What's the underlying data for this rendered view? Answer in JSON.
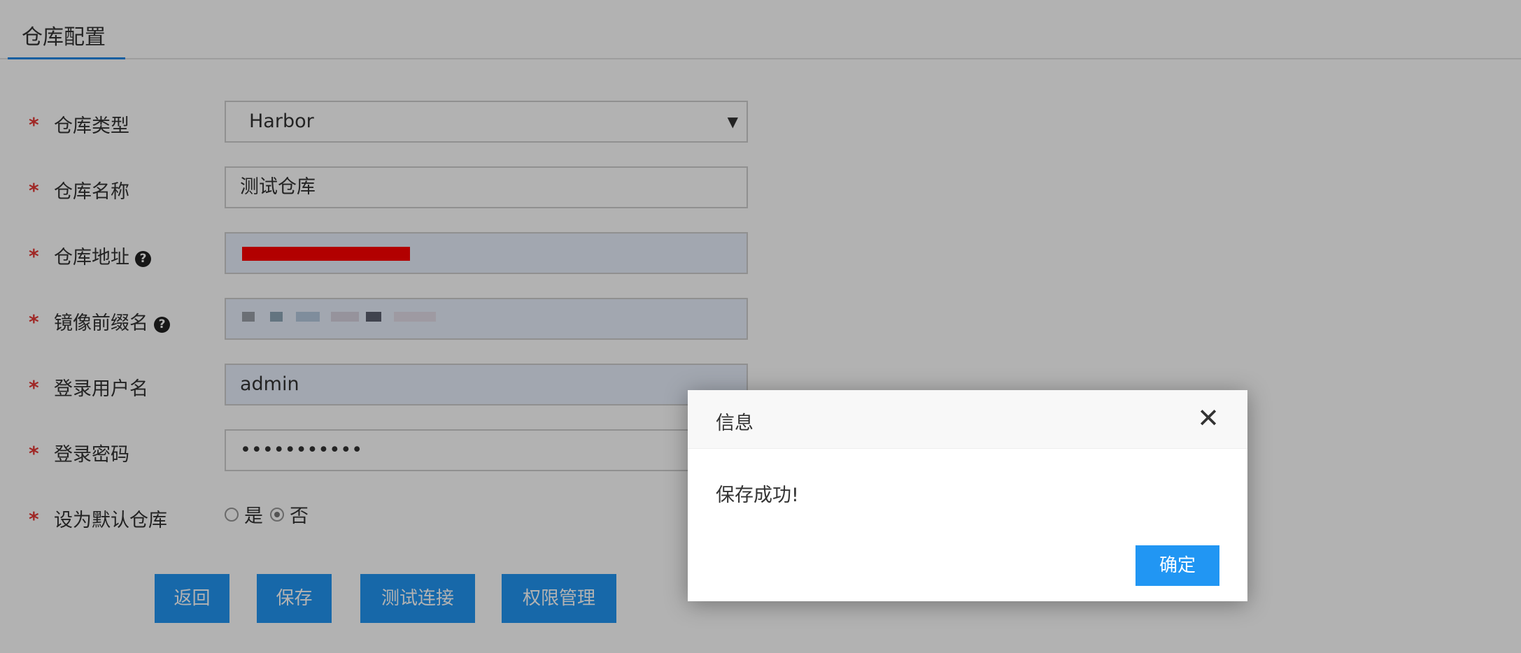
{
  "tab": {
    "label": "仓库配置"
  },
  "form": {
    "repo_type": {
      "label": "仓库类型",
      "value": "Harbor"
    },
    "repo_name": {
      "label": "仓库名称",
      "value": "测试仓库"
    },
    "repo_address": {
      "label": "仓库地址"
    },
    "image_prefix": {
      "label": "镜像前缀名"
    },
    "username": {
      "label": "登录用户名",
      "value": "admin"
    },
    "password": {
      "label": "登录密码",
      "value": "•••••••••••"
    },
    "default_repo": {
      "label": "设为默认仓库",
      "yes_label": "是",
      "no_label": "否",
      "selected": "否"
    },
    "required_mark": "*",
    "help_glyph": "?"
  },
  "buttons": {
    "back": "返回",
    "save": "保存",
    "test_connection": "测试连接",
    "permission_manage": "权限管理"
  },
  "dialog": {
    "title": "信息",
    "message": "保存成功!",
    "ok_label": "确定",
    "close_glyph": "✕"
  },
  "colors": {
    "primary": "#2196f3",
    "required": "#e53935",
    "tab_underline": "#1e88e5",
    "redaction": "#ff0000"
  },
  "icons": {
    "help": "question-circle-icon",
    "close": "close-icon",
    "caret": "caret-down-icon"
  }
}
